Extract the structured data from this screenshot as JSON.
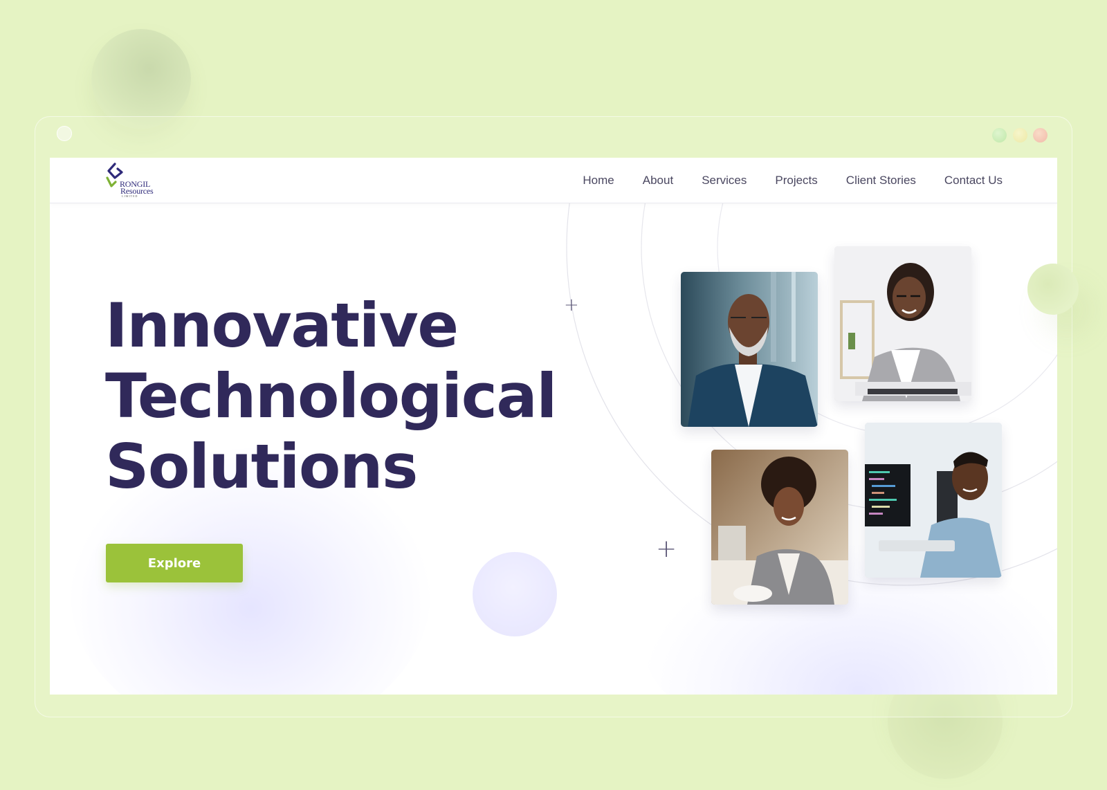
{
  "logo": {
    "line1": "RONGIL",
    "line2": "Resources",
    "line3": "LIMITED"
  },
  "nav": {
    "items": [
      "Home",
      "About",
      "Services",
      "Projects",
      "Client Stories",
      "Contact Us"
    ]
  },
  "hero": {
    "title_lines": [
      "Innovative",
      "Technological",
      "Solutions"
    ],
    "cta_label": "Explore"
  },
  "photos": [
    "businessman-in-blue-suit-photo",
    "woman-on-phone-at-laptop-photo",
    "woman-in-grey-blazer-at-desk-photo",
    "man-at-computer-coding-photo"
  ],
  "colors": {
    "background": "#e5f3c3",
    "title": "#30295a",
    "cta": "#9bc23a",
    "nav_text": "#4a4760",
    "logo_primary": "#2f2a7a",
    "logo_accent": "#7fb236"
  }
}
